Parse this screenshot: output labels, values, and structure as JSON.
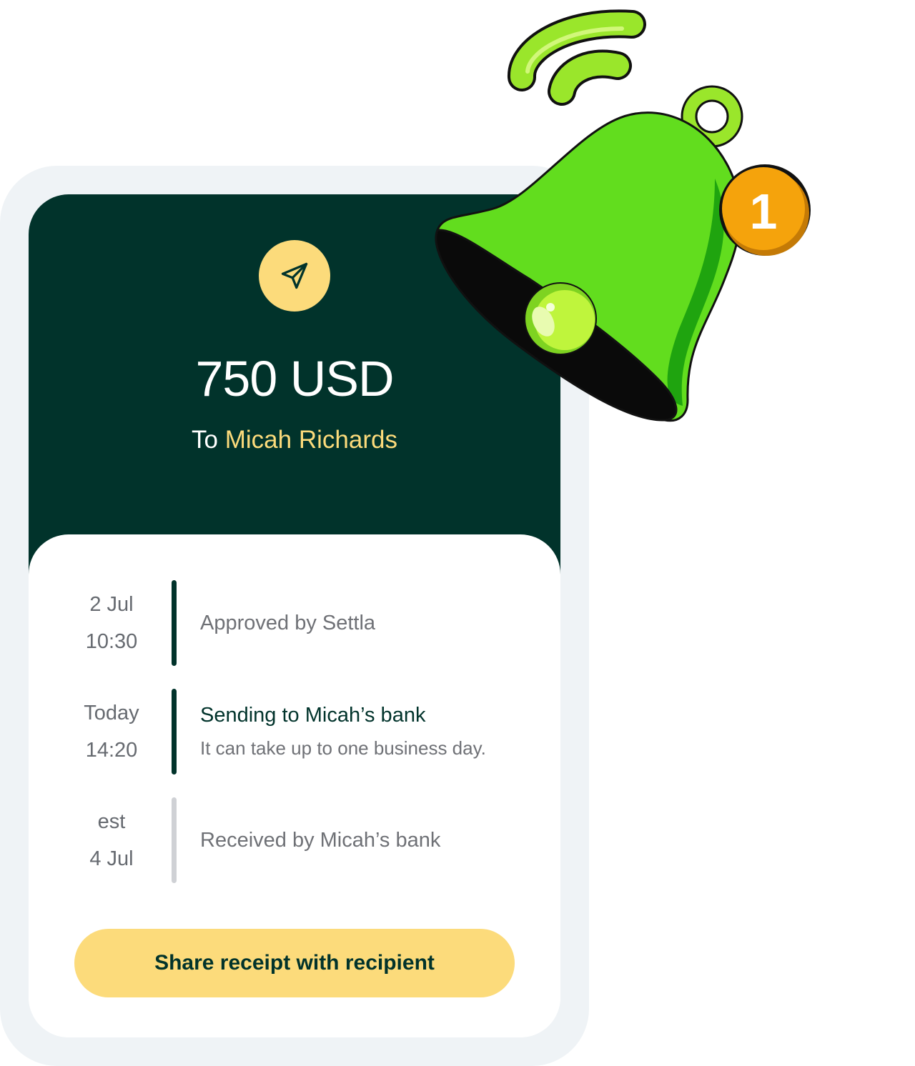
{
  "transfer": {
    "amount": "750 USD",
    "to_prefix": "To",
    "recipient": "Micah Richards"
  },
  "timeline": [
    {
      "date": "2 Jul",
      "time": "10:30",
      "title": "Approved by Settla",
      "status": "done"
    },
    {
      "date": "Today",
      "time": "14:20",
      "title": "Sending to Micah’s bank",
      "subtitle": "It can take up to one business day.",
      "status": "active"
    },
    {
      "date": "est",
      "time": "4 Jul",
      "title": "Received by Micah’s bank",
      "status": "pending"
    }
  ],
  "actions": {
    "share_label": "Share receipt with recipient"
  },
  "notification": {
    "icon": "bell-icon",
    "count": "1"
  },
  "colors": {
    "header_bg": "#01332b",
    "accent_yellow": "#fcdb7b",
    "bell_green": "#62dd1e",
    "badge_orange": "#f5a30c"
  }
}
